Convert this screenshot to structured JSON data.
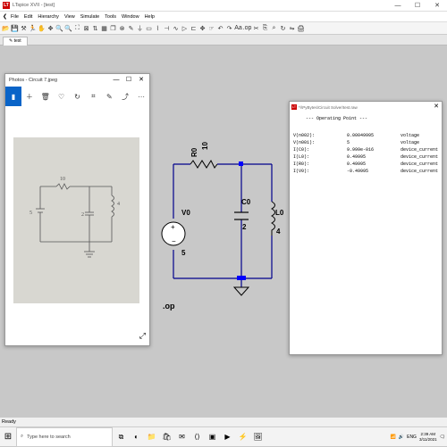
{
  "window": {
    "title": "LTspice XVII - [test]",
    "controls": [
      "—",
      "☐",
      "✕"
    ]
  },
  "menu": [
    "File",
    "Edit",
    "Hierarchy",
    "View",
    "Simulate",
    "Tools",
    "Window",
    "Help"
  ],
  "tab": {
    "label": "test"
  },
  "photos": {
    "title": "Photos - Circuit 7.jpeg",
    "controls": [
      "—",
      "☐",
      "✕"
    ],
    "photo_labels": {
      "resistor": "10",
      "supply": "5",
      "cap": "2",
      "ind": "4"
    }
  },
  "schematic": {
    "resistor_name": "R0",
    "resistor_value": "10",
    "source_name": "V0",
    "source_value": "5",
    "cap_name": "C0",
    "cap_value": "2",
    "ind_name": "L0",
    "ind_value": "4",
    "directive": ".op"
  },
  "output": {
    "title": "*\\\\PyBytes\\Circuit Solver\\test.raw",
    "header": "--- Operating Point ---",
    "rows": [
      {
        "name": "V(n002):",
        "value": "0.00049995",
        "type": "voltage"
      },
      {
        "name": "V(n001):",
        "value": "5",
        "type": "voltage"
      },
      {
        "name": "I(C0):",
        "value": "9.999e-016",
        "type": "device_current"
      },
      {
        "name": "I(L0):",
        "value": "0.49995",
        "type": "device_current"
      },
      {
        "name": "I(R0):",
        "value": "0.49995",
        "type": "device_current"
      },
      {
        "name": "I(V0):",
        "value": "-0.49995",
        "type": "device_current"
      }
    ]
  },
  "status": {
    "text": "Ready"
  },
  "taskbar": {
    "search_placeholder": "Type here to search",
    "time": "2:39 AM",
    "date": "3/11/2021",
    "lang": "ENG"
  },
  "colors": {
    "wire": "#00008b",
    "component": "#000000",
    "node": "#0000ff",
    "accent": "#0a64c8"
  }
}
